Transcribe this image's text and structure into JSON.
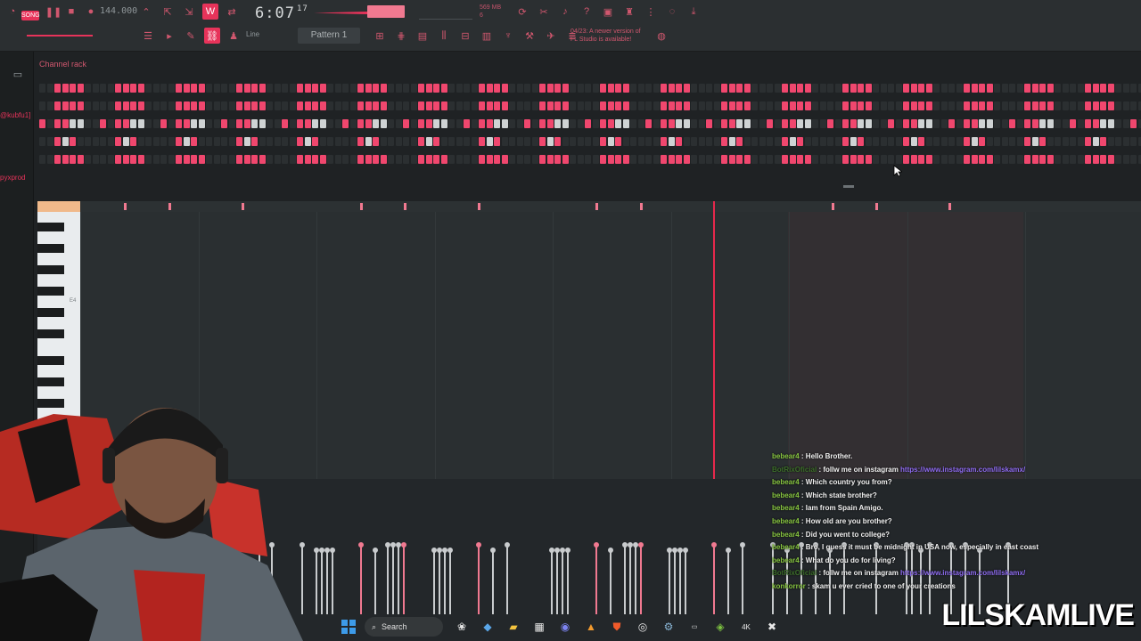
{
  "toolbar": {
    "mode_badge": "SONG",
    "tempo": "144.000",
    "time_main": "6:07",
    "time_ticks": "17",
    "pattern": "Pattern 1",
    "snap": "Line",
    "memory_label": "569 MB",
    "memory_sub": "6",
    "news_line1": "04/23: A newer version of",
    "news_line2": "FL Studio is available!"
  },
  "sidebar": {
    "user1": "@kubfu1]",
    "user2": "pyxprod"
  },
  "channel_rack": {
    "title": "Channel rack"
  },
  "piano_roll": {
    "key_label": "E4"
  },
  "chat": {
    "messages": [
      {
        "user": "bebear4",
        "text": ": Hello Brother."
      },
      {
        "user": "BotRixOficial",
        "text": ": follw me on instagram ",
        "link": "https://www.instagram.com/lilskamx/"
      },
      {
        "user": "bebear4",
        "text": ": Which country you from?"
      },
      {
        "user": "bebear4",
        "text": ": Which state brother?"
      },
      {
        "user": "bebear4",
        "text": ": Iam from Spain Amigo."
      },
      {
        "user": "bebear4",
        "text": ": How old are you brother?"
      },
      {
        "user": "bebear4",
        "text": ": Did you went to college?"
      },
      {
        "user": "bebear4",
        "text": ": Bro, I guess it must be midnight in USA now, especially in east coast"
      },
      {
        "user": "bebear4",
        "text": ": What do you do for living?"
      },
      {
        "user": "BotRixOficial",
        "text": ": follw me on instagram ",
        "link": "https://www.instagram.com/lilskamx/"
      },
      {
        "user": "konkorror",
        "text": ": skam u ever cried to one of your creations"
      }
    ]
  },
  "taskbar": {
    "search": "Search"
  },
  "overlay": {
    "brand": "LILSKAMLIVE"
  }
}
